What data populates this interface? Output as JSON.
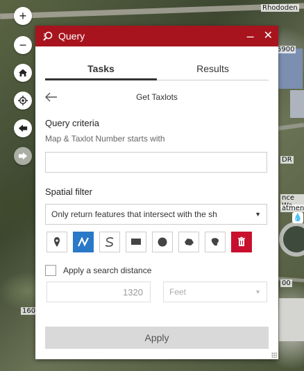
{
  "map": {
    "labels": [
      "Rhododen",
      "5900",
      "DR",
      "nce Wa",
      "atment",
      "00",
      "160"
    ]
  },
  "nav": [
    {
      "name": "zoom-in-icon",
      "glyph": "+"
    },
    {
      "name": "zoom-out-icon",
      "glyph": "−"
    }
  ],
  "panel": {
    "title": "Query",
    "minimize": "–",
    "close": "✕",
    "tabs": [
      "Tasks",
      "Results"
    ],
    "active_tab": "Tasks",
    "task_title": "Get Taxlots",
    "query_criteria_label": "Query criteria",
    "query_hint": "Map & Taxlot Number starts with",
    "query_value": "",
    "spatial_filter_label": "Spatial filter",
    "spatial_filter_value": "Only return features that intersect with the sh",
    "tools": [
      {
        "name": "point-tool",
        "selected": false
      },
      {
        "name": "line-tool",
        "selected": true
      },
      {
        "name": "freehand-line-tool",
        "selected": false
      },
      {
        "name": "rectangle-tool",
        "selected": false
      },
      {
        "name": "circle-tool",
        "selected": false
      },
      {
        "name": "polygon-tool",
        "selected": false
      },
      {
        "name": "freehand-polygon-tool",
        "selected": false
      },
      {
        "name": "clear-tool",
        "selected": false
      }
    ],
    "distance_label": "Apply a search distance",
    "distance_checked": false,
    "distance_value": "1320",
    "distance_unit": "Feet",
    "apply_label": "Apply"
  },
  "colors": {
    "header": "#a8141e",
    "tool_selected": "#2a78c8",
    "tool_danger": "#c8102e"
  }
}
